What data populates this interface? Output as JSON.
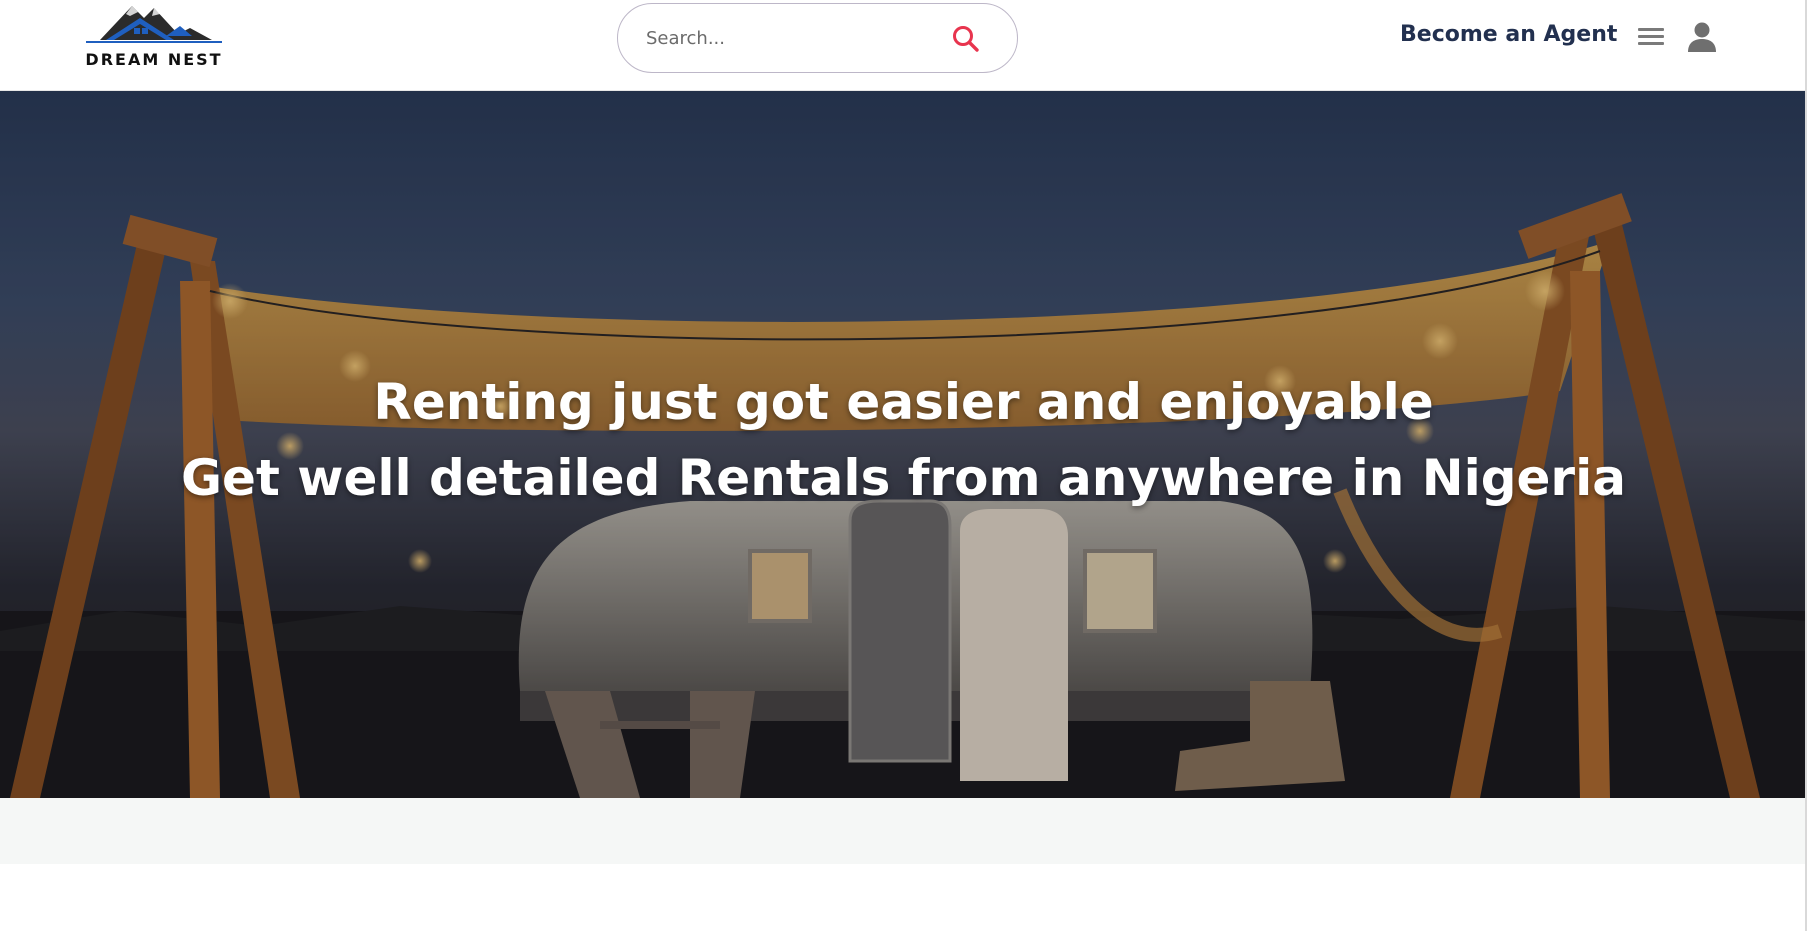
{
  "brand": {
    "name": "DREAM NEST",
    "logo_icon": "mountain-house-logo"
  },
  "search": {
    "placeholder": "Search...",
    "value": "",
    "icon": "search-icon",
    "icon_color": "#e8344e"
  },
  "nav": {
    "agent_link": "Become an Agent",
    "menu_icon": "hamburger-icon",
    "user_icon": "user-icon"
  },
  "hero": {
    "line1": "Renting just got easier and enjoyable",
    "line2": "Get well detailed Rentals from anywhere in Nigeria"
  },
  "colors": {
    "agent_link": "#22304f",
    "logo_blue": "#1f5fbf",
    "logo_dark": "#1a1a1a"
  }
}
